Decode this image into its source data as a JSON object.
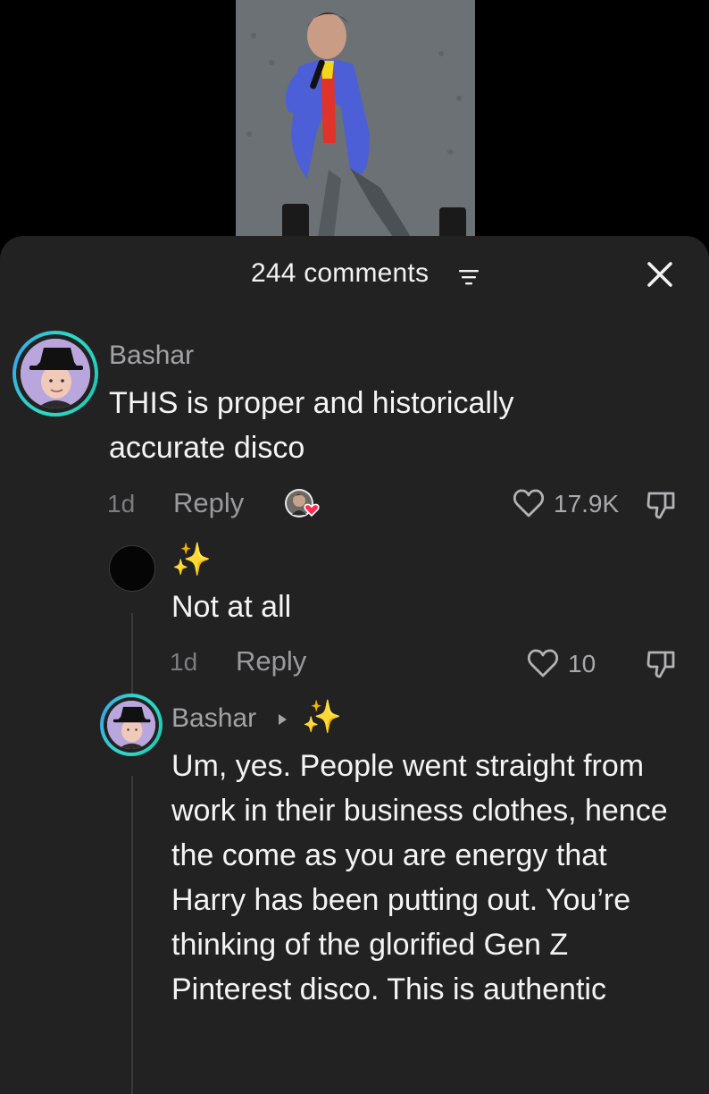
{
  "header": {
    "comments_label": "244 comments",
    "filter_icon": "filter-icon",
    "close_icon": "close-icon"
  },
  "comments": [
    {
      "username": "Bashar",
      "text": "THIS is proper and historically accurate disco",
      "time": "1d",
      "reply_label": "Reply",
      "likes": "17.9K",
      "creator_liked": true
    }
  ],
  "replies": [
    {
      "username": "✨",
      "text": "Not at all",
      "time": "1d",
      "reply_label": "Reply",
      "likes": "10"
    },
    {
      "username": "Bashar",
      "reply_to": "✨",
      "text": "Um, yes. People went straight from work in their business clothes, hence the come as you are energy that Harry has been putting out. You’re thinking of the glorified Gen Z Pinterest disco. This is authentic"
    }
  ],
  "colors": {
    "sheet_bg": "#222223",
    "ring": "#2fd9c4",
    "text_primary": "#f4f4f4",
    "text_secondary": "#a3a3a6"
  }
}
